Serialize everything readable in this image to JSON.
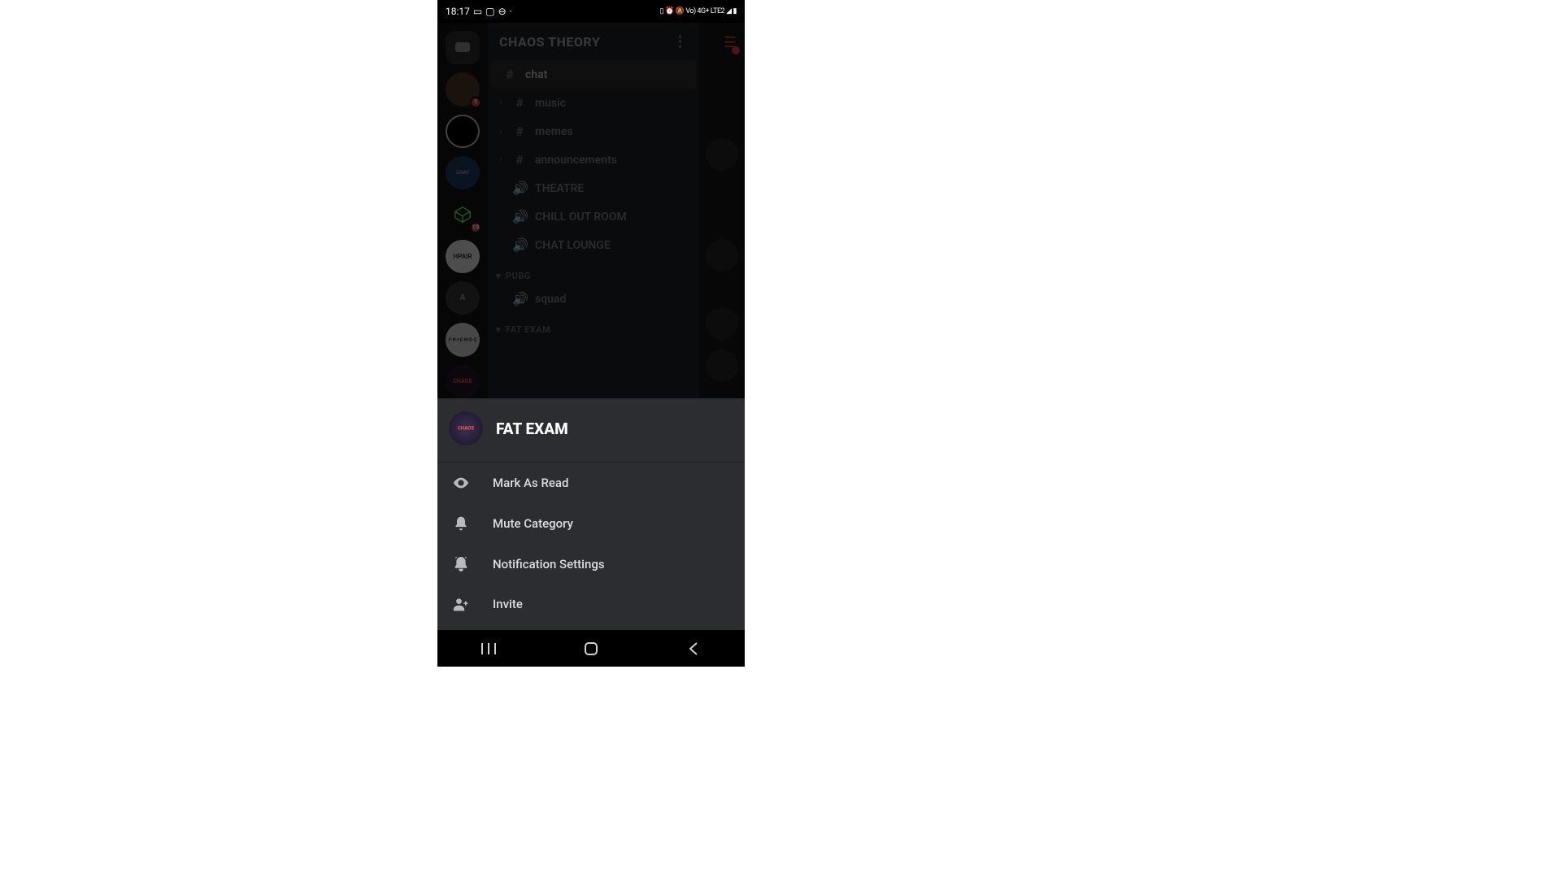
{
  "status": {
    "time": "18:17",
    "indicators": "Vo) 4G+ LTE2"
  },
  "server": {
    "title": "CHAOS THEORY"
  },
  "channels": {
    "chat": "chat",
    "music": "music",
    "memes": "memes",
    "announcements": "announcements",
    "theatre": "THEATRE",
    "chillout": "CHILL OUT ROOM",
    "lounge": "CHAT LOUNGE"
  },
  "categories": {
    "pubg": "PUBG",
    "squad": "squad",
    "fatexam": "FAT EXAM"
  },
  "guilds": {
    "badge1": "1",
    "badge2": "19",
    "a": "A",
    "hpair": "HPAIR"
  },
  "sheet": {
    "title": "FAT EXAM",
    "mark_read": "Mark As Read",
    "mute": "Mute Category",
    "notif": "Notification Settings",
    "invite": "Invite"
  }
}
